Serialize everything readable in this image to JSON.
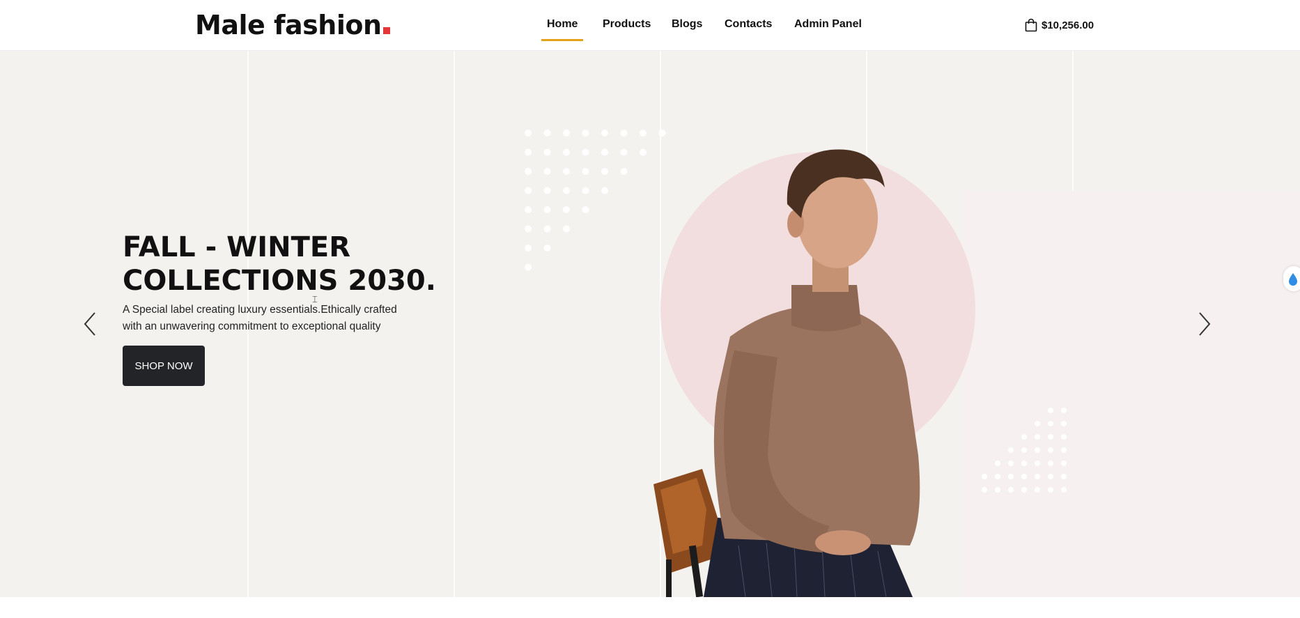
{
  "brand": {
    "logo_text": "Male fashion",
    "accent_color": "#e53637"
  },
  "nav": {
    "items": [
      {
        "label": "Home",
        "active": true
      },
      {
        "label": "Products",
        "active": false
      },
      {
        "label": "Blogs",
        "active": false
      },
      {
        "label": "Contacts",
        "active": false
      },
      {
        "label": "Admin Panel",
        "active": false
      }
    ],
    "active_indicator_color": "#e5a11a"
  },
  "cart": {
    "icon": "shopping-bag-icon",
    "total": "$10,256.00"
  },
  "hero": {
    "title_line1": "FALL - WINTER",
    "title_line2": "COLLECTIONS 2030.",
    "description_line1": "A Special label creating luxury essentials.Ethically crafted",
    "description_line2": "with an unwavering commitment to exceptional quality",
    "cta_label": "SHOP NOW",
    "prev_icon": "chevron-left-icon",
    "next_icon": "chevron-right-icon",
    "background_color": "#f3f2ef",
    "circle_color": "#f2dede",
    "button_color": "#232428"
  }
}
